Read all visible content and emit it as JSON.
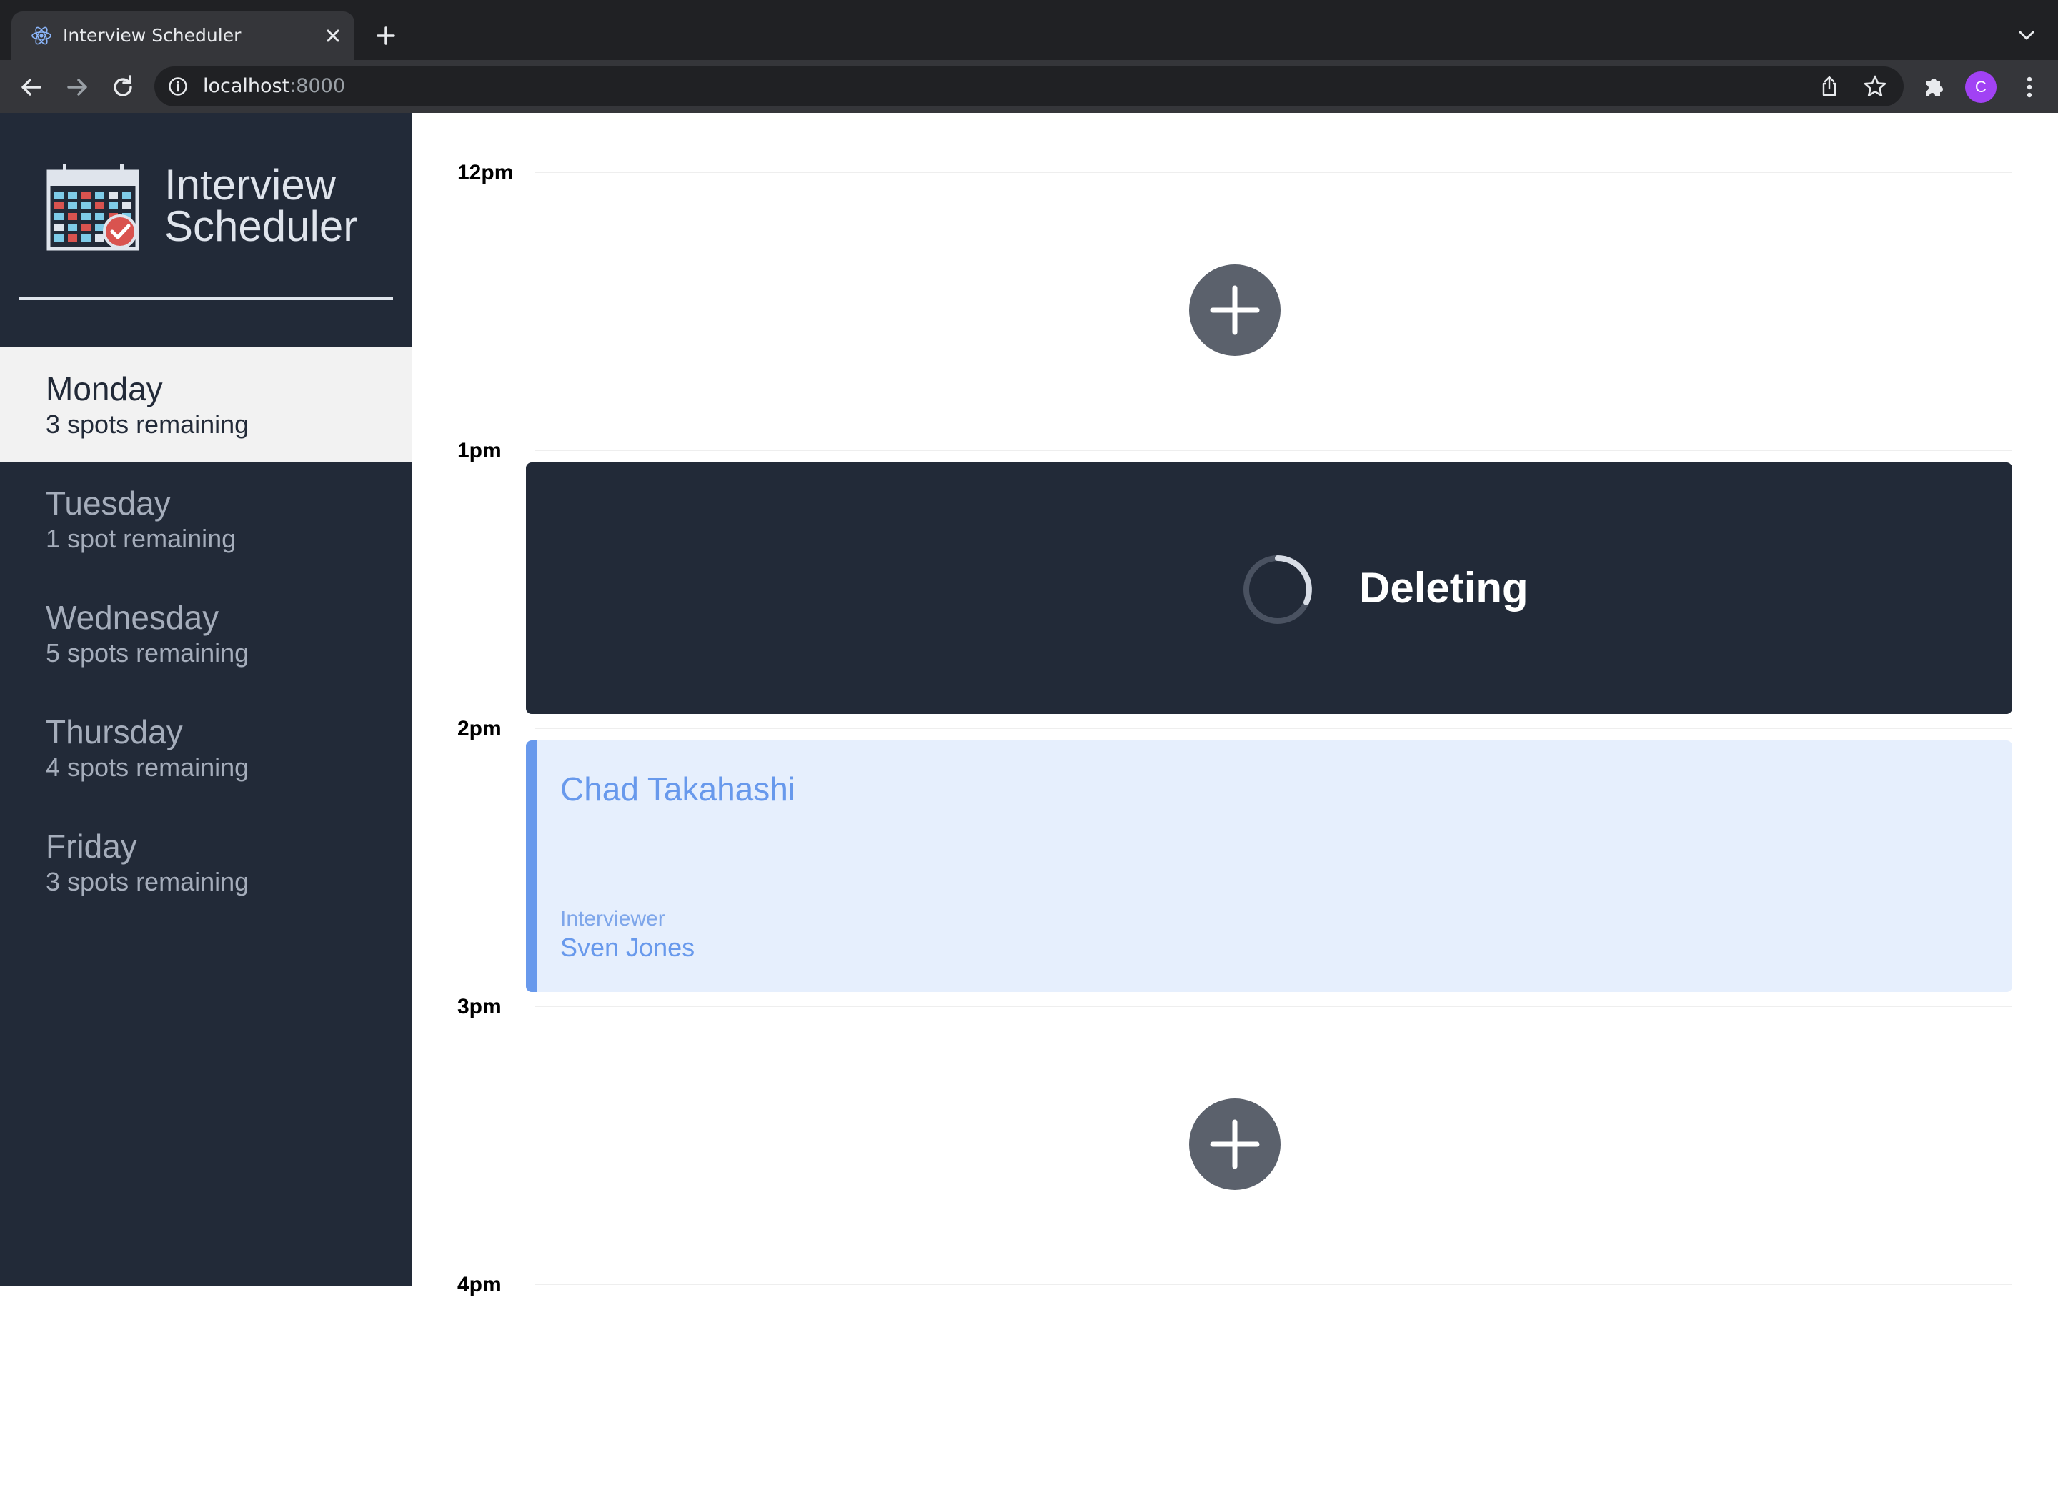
{
  "browser": {
    "tab_title": "Interview Scheduler",
    "url_host": "localhost",
    "url_port": ":8000",
    "avatar_letter": "C",
    "icons": [
      "react-favicon-icon",
      "close-icon",
      "plus-icon",
      "chevron-down-icon",
      "back-arrow-icon",
      "forward-arrow-icon",
      "reload-icon",
      "info-icon",
      "share-icon",
      "star-icon",
      "puzzle-icon",
      "kebab-menu-icon"
    ]
  },
  "sidebar": {
    "brand_line1": "Interview",
    "brand_line2": "Scheduler",
    "days": [
      {
        "name": "Monday",
        "spots": "3 spots remaining",
        "selected": true
      },
      {
        "name": "Tuesday",
        "spots": "1 spot remaining",
        "selected": false
      },
      {
        "name": "Wednesday",
        "spots": "5 spots remaining",
        "selected": false
      },
      {
        "name": "Thursday",
        "spots": "4 spots remaining",
        "selected": false
      },
      {
        "name": "Friday",
        "spots": "3 spots remaining",
        "selected": false
      }
    ]
  },
  "schedule": {
    "slots": [
      {
        "time": "12pm",
        "state": "empty"
      },
      {
        "time": "1pm",
        "state": "status",
        "status_text": "Deleting"
      },
      {
        "time": "2pm",
        "state": "show",
        "student": "Chad Takahashi",
        "interviewer_label": "Interviewer",
        "interviewer": "Sven Jones"
      },
      {
        "time": "3pm",
        "state": "empty"
      },
      {
        "time": "4pm",
        "state": "empty"
      }
    ]
  },
  "colors": {
    "sidebar_bg": "#222a38",
    "selected_day_bg": "#f2f2f2",
    "status_bg": "#222a38",
    "show_bg": "#e6effd",
    "show_accent": "#6899ec",
    "add_button": "#5b616c",
    "avatar": "#a142f4"
  }
}
